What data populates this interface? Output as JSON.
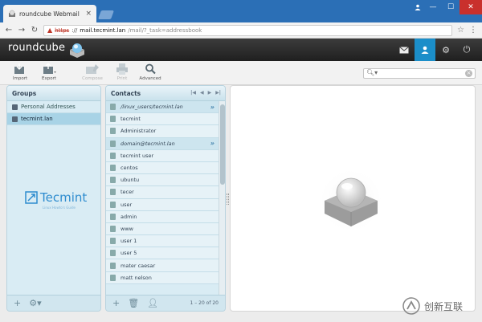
{
  "browser": {
    "tab_title": "roundcube Webmail :: A",
    "tab_close": "×",
    "url": {
      "scheme": "https",
      "separator": "://",
      "host": "mail.tecmint.lan",
      "path": "/mail/?_task=addressbook"
    },
    "window_buttons": {
      "minimize": "—",
      "maximize": "☐",
      "close": "✕"
    }
  },
  "app": {
    "logo_text": "roundcube",
    "nav_icons": [
      "mail-icon",
      "contacts-icon",
      "settings-icon",
      "logout-icon"
    ]
  },
  "toolbar": {
    "import_label": "Import",
    "export_label": "Export",
    "compose_label": "Compose",
    "print_label": "Print",
    "advanced_label": "Advanced"
  },
  "groups": {
    "title": "Groups",
    "items": [
      {
        "label": "Personal Addresses"
      },
      {
        "label": "tecmint.lan"
      }
    ]
  },
  "watermark": {
    "text": "Tecmint",
    "sub": "Linux Howto's Guide"
  },
  "contacts": {
    "title": "Contacts",
    "count_text": "1 – 20 of 20",
    "items": [
      {
        "label": "/linux_users/tecmint.lan",
        "group": true,
        "arrow": "»"
      },
      {
        "label": "tecmint",
        "group": false
      },
      {
        "label": "Administrator",
        "group": false
      },
      {
        "label": "domain@tecmint.lan",
        "group": true,
        "arrow": "»"
      },
      {
        "label": "tecmint user",
        "group": false
      },
      {
        "label": "centos",
        "group": false
      },
      {
        "label": "ubuntu",
        "group": false
      },
      {
        "label": "tecer",
        "group": false
      },
      {
        "label": "user",
        "group": false
      },
      {
        "label": "admin",
        "group": false
      },
      {
        "label": "www",
        "group": false
      },
      {
        "label": "user 1",
        "group": false
      },
      {
        "label": "user 5",
        "group": false
      },
      {
        "label": "mater caesar",
        "group": false
      },
      {
        "label": "matt nelson",
        "group": false
      }
    ]
  },
  "corner_watermark": {
    "text": "创新互联"
  }
}
